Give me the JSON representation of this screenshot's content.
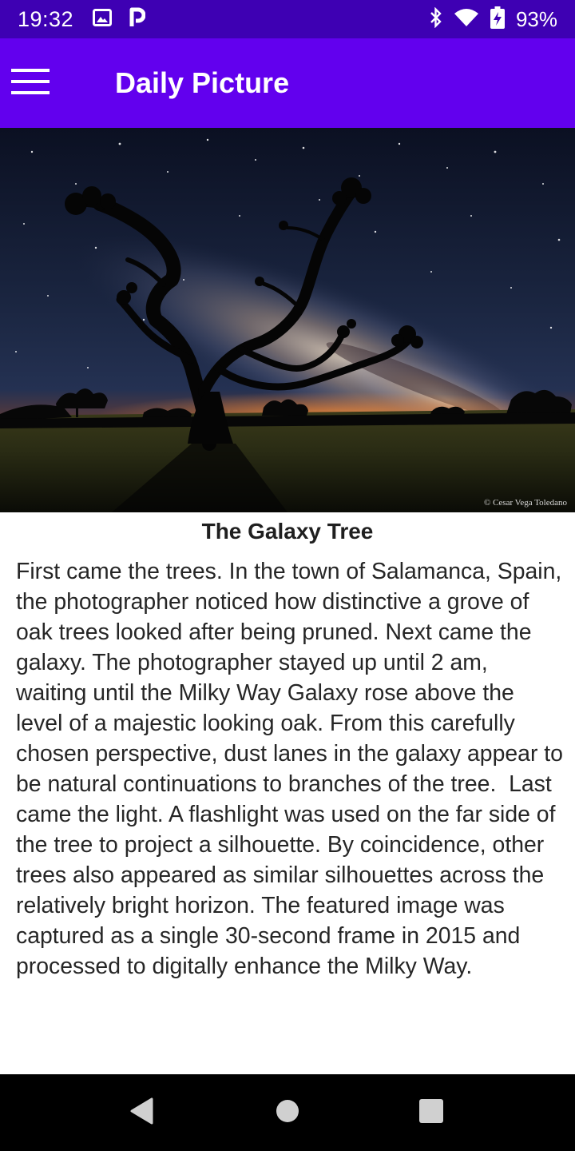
{
  "status_bar": {
    "time": "19:32",
    "battery_percent": "93%",
    "left_icons": [
      "image-icon",
      "parking-icon"
    ],
    "right_icons": [
      "bluetooth-icon",
      "wifi-icon",
      "battery-charging-icon"
    ]
  },
  "app_bar": {
    "title": "Daily Picture",
    "menu_icon": "menu-icon"
  },
  "picture": {
    "photo_credit": "© Cesar Vega Toledano",
    "title": "The Galaxy Tree",
    "description": "First came the trees. In the town of Salamanca, Spain, the photographer noticed how distinctive a grove of oak trees looked after being pruned. Next came the galaxy. The photographer stayed up until 2 am, waiting until the Milky Way Galaxy rose above the level of a majestic looking oak. From this carefully chosen perspective, dust lanes in the galaxy appear to be natural continuations to branches of the tree.  Last came the light. A flashlight was used on the far side of the tree to project a silhouette. By coincidence, other trees also appeared as similar silhouettes across the relatively bright horizon. The featured image was captured as a single 30-second frame in 2015 and processed to digitally enhance the Milky Way."
  },
  "nav_bar": {
    "buttons": [
      "back-icon",
      "home-icon",
      "recents-icon"
    ]
  },
  "colors": {
    "status_bar": "#3e00b3",
    "app_bar": "#6200ee",
    "nav_bar": "#000000",
    "text": "#262626"
  }
}
